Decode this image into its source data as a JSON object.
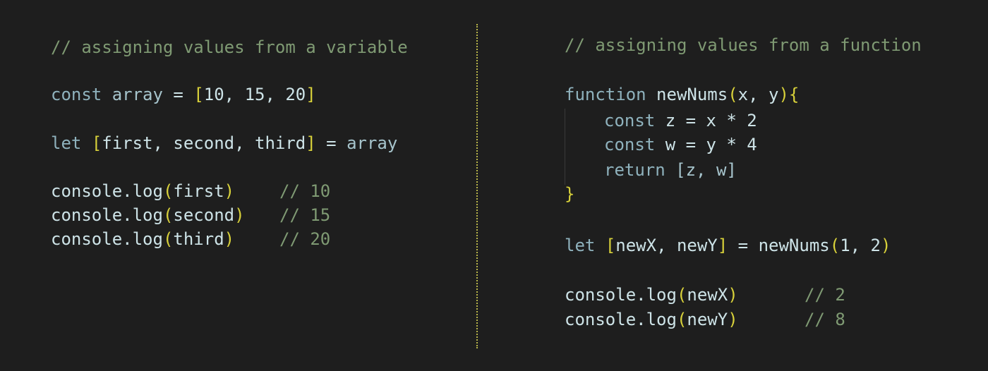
{
  "left_panel": {
    "comment": "// assigning values from a variable",
    "line_array": {
      "kw": "const",
      "name": "array",
      "eq": "=",
      "open": "[",
      "values": "10, 15, 20",
      "close": "]"
    },
    "line_let": {
      "kw": "let",
      "open": "[",
      "names": "first, second, third",
      "close": "]",
      "eq": "=",
      "source": "array"
    },
    "logs": [
      {
        "call": "console.log",
        "open": "(",
        "arg": "first",
        "close": ")",
        "comment": "// 10"
      },
      {
        "call": "console.log",
        "open": "(",
        "arg": "second",
        "close": ")",
        "comment": "// 15"
      },
      {
        "call": "console.log",
        "open": "(",
        "arg": "third",
        "close": ")",
        "comment": "// 20"
      }
    ]
  },
  "right_panel": {
    "comment": "// assigning values from a function",
    "fn_header": {
      "kw": "function",
      "name": "newNums",
      "open": "(",
      "params": "x, y",
      "close": ")",
      "brace": "{"
    },
    "fn_body": [
      {
        "kw": "const",
        "rest": "z = x * 2"
      },
      {
        "kw": "const",
        "rest": "w = y * 4"
      },
      {
        "kw": "return",
        "rest": "[z, w]"
      }
    ],
    "fn_close": "}",
    "line_let": {
      "kw": "let",
      "open": "[",
      "names": "newX, newY",
      "close": "]",
      "eq": "=",
      "call": "newNums",
      "call_open": "(",
      "args": "1, 2",
      "call_close": ")"
    },
    "logs": [
      {
        "call": "console.log",
        "open": "(",
        "arg": "newX",
        "close": ")",
        "comment": "// 2"
      },
      {
        "call": "console.log",
        "open": "(",
        "arg": "newY",
        "close": ")",
        "comment": "// 8"
      }
    ]
  },
  "colors": {
    "background": "#1e1e1e",
    "comment": "#7f9a73",
    "bracket": "#d8d13a",
    "text": "#cde3e7",
    "divider": "#b7b449"
  }
}
